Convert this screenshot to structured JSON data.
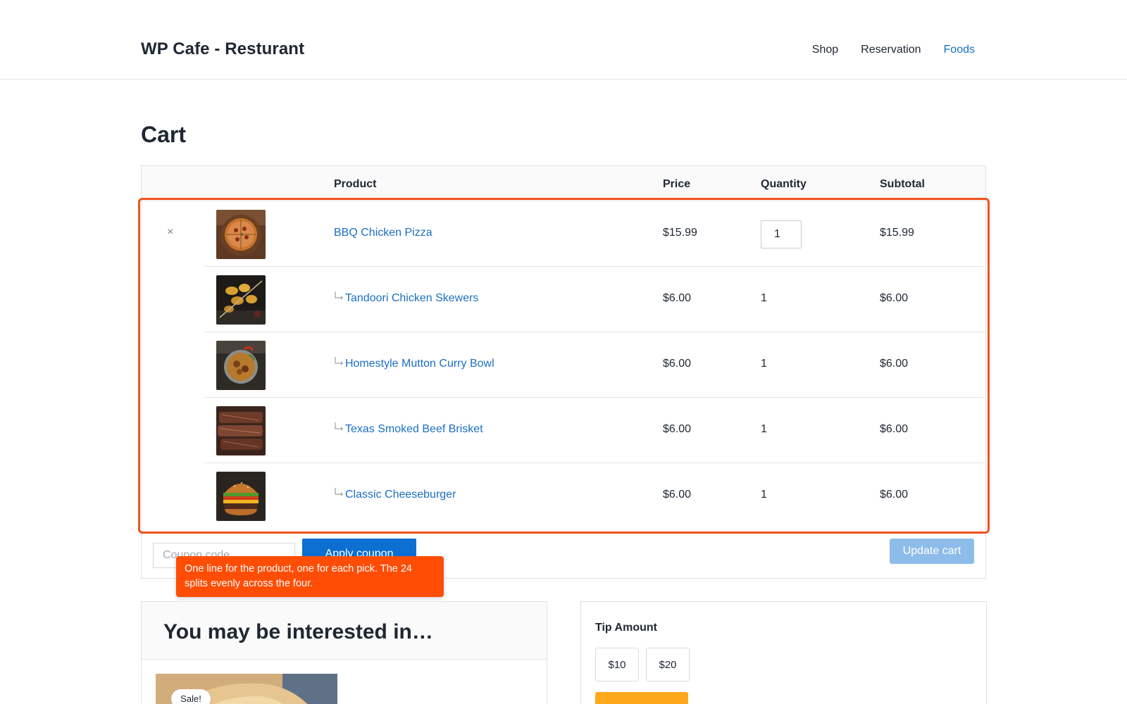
{
  "header": {
    "site_title": "WP Cafe - Resturant",
    "nav": [
      {
        "label": "Shop",
        "active": false
      },
      {
        "label": "Reservation",
        "active": false
      },
      {
        "label": "Foods",
        "active": true
      }
    ]
  },
  "page": {
    "title": "Cart"
  },
  "cart": {
    "columns": {
      "product": "Product",
      "price": "Price",
      "quantity": "Quantity",
      "subtotal": "Subtotal"
    },
    "remove_glyph": "×",
    "child_marker_icon": "corner-down-right-icon",
    "items": [
      {
        "name": "BBQ Chicken Pizza",
        "price": "$15.99",
        "quantity": "1",
        "subtotal": "$15.99",
        "image": "bbq-chicken-pizza"
      },
      {
        "name": "Tandoori Chicken Skewers",
        "price": "$6.00",
        "quantity": "1",
        "subtotal": "$6.00",
        "image": "tandoori-chicken-skewers"
      },
      {
        "name": "Homestyle Mutton Curry Bowl",
        "price": "$6.00",
        "quantity": "1",
        "subtotal": "$6.00",
        "image": "mutton-curry-bowl"
      },
      {
        "name": "Texas Smoked Beef Brisket",
        "price": "$6.00",
        "quantity": "1",
        "subtotal": "$6.00",
        "image": "smoked-beef-brisket"
      },
      {
        "name": "Classic Cheeseburger",
        "price": "$6.00",
        "quantity": "1",
        "subtotal": "$6.00",
        "image": "classic-cheeseburger"
      }
    ],
    "coupon_placeholder": "Coupon code",
    "apply_coupon_label": "Apply coupon",
    "update_cart_label": "Update cart"
  },
  "annotation": {
    "tooltip_text": "One line for the product, one for each pick. The 24 splits evenly across the four.",
    "highlight_color": "#f0521e",
    "tooltip_color": "#ff4d05"
  },
  "interested": {
    "title": "You may be interested in…",
    "sale_badge": "Sale!"
  },
  "tip": {
    "label": "Tip Amount",
    "options": [
      "$10",
      "$20"
    ]
  },
  "colors": {
    "link": "#1b6fc2",
    "primary_button": "#0c6fd1",
    "disabled_button": "#8ebcea",
    "tip_accent": "#ffa81a"
  }
}
